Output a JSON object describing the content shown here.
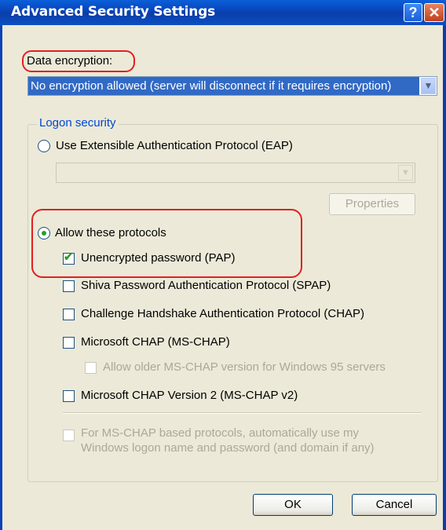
{
  "window": {
    "title": "Advanced Security Settings",
    "help_glyph": "?",
    "close_glyph": "✕"
  },
  "encryption": {
    "label": "Data encryption:",
    "selected": "No encryption allowed (server will disconnect if it requires encryption)"
  },
  "logon": {
    "legend": "Logon security",
    "eap_label": "Use Extensible Authentication Protocol (EAP)",
    "eap_selected": false,
    "properties_label": "Properties",
    "allow_label": "Allow these protocols",
    "allow_selected": true,
    "protocols": [
      {
        "label": "Unencrypted password (PAP)",
        "checked": true,
        "enabled": true
      },
      {
        "label": "Shiva Password Authentication Protocol (SPAP)",
        "checked": false,
        "enabled": true
      },
      {
        "label": "Challenge Handshake Authentication Protocol (CHAP)",
        "checked": false,
        "enabled": true
      },
      {
        "label": "Microsoft CHAP (MS-CHAP)",
        "checked": false,
        "enabled": true
      },
      {
        "label": "Allow older MS-CHAP version for Windows 95 servers",
        "checked": false,
        "enabled": false
      },
      {
        "label": "Microsoft CHAP Version 2 (MS-CHAP v2)",
        "checked": false,
        "enabled": true
      }
    ],
    "auto_logon_line1": "For MS-CHAP based protocols, automatically use my",
    "auto_logon_line2": "Windows logon name and password (and domain if any)"
  },
  "buttons": {
    "ok": "OK",
    "cancel": "Cancel"
  },
  "colors": {
    "titlebar": "#0842b8",
    "selection": "#316ac5",
    "groupbox_legend": "#0046d5",
    "annotation": "#e02020",
    "check": "#21a121"
  },
  "icons": [
    "help-icon",
    "close-icon",
    "chevron-down-icon",
    "checkmark-icon"
  ]
}
